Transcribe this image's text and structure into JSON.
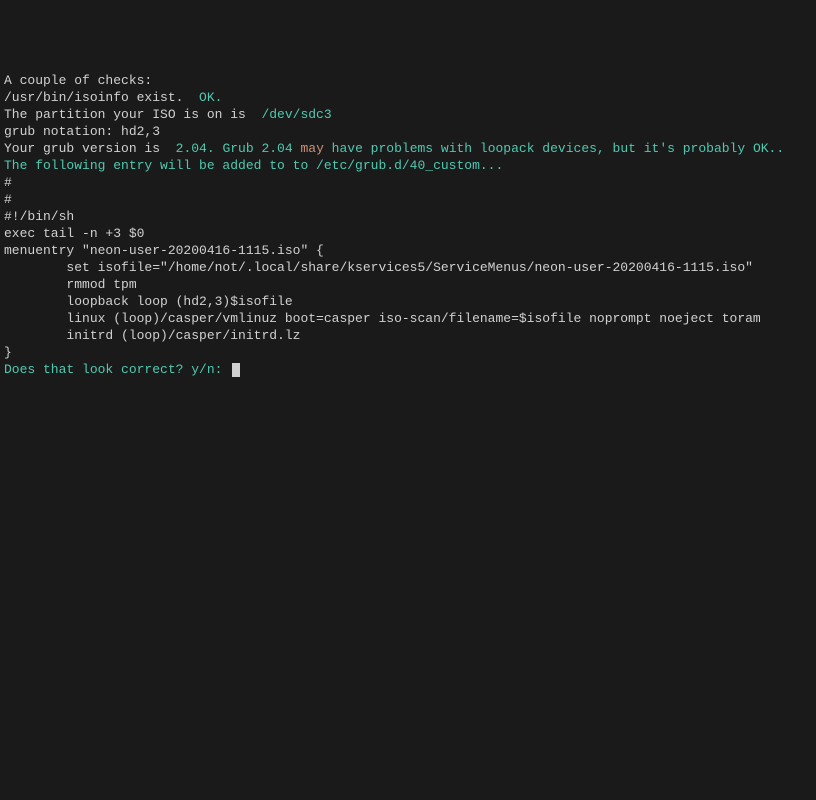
{
  "lines": {
    "l1": "A couple of checks:",
    "l2a": "/usr/bin/isoinfo exist.  ",
    "l2b": "OK.",
    "l3": "",
    "l4a": "The partition your ISO is on is  ",
    "l4b": "/dev/sdc3",
    "l5": "grub notation: hd2,3",
    "l6": "",
    "l7a": "Your grub version is  ",
    "l7b": "2.04. Grub 2.04 ",
    "l7c": "may",
    "l7d": " have problems with loopack devices, but it's probably OK..",
    "l8": "",
    "l9": "The following entry will be added to to /etc/grub.d/40_custom...",
    "l10": "#",
    "l11": "#",
    "l12": "#!/bin/sh",
    "l13": "exec tail -n +3 $0",
    "l14": "menuentry \"neon-user-20200416-1115.iso\" {",
    "l15": "        set isofile=\"/home/not/.local/share/kservices5/ServiceMenus/neon-user-20200416-1115.iso\"",
    "l16": "        rmmod tpm",
    "l17": "        loopback loop (hd2,3)$isofile",
    "l18": "        linux (loop)/casper/vmlinuz boot=casper iso-scan/filename=$isofile noprompt noeject toram",
    "l19": "        initrd (loop)/casper/initrd.lz",
    "l20": "}",
    "l21": "Does that look correct? y/n: "
  }
}
